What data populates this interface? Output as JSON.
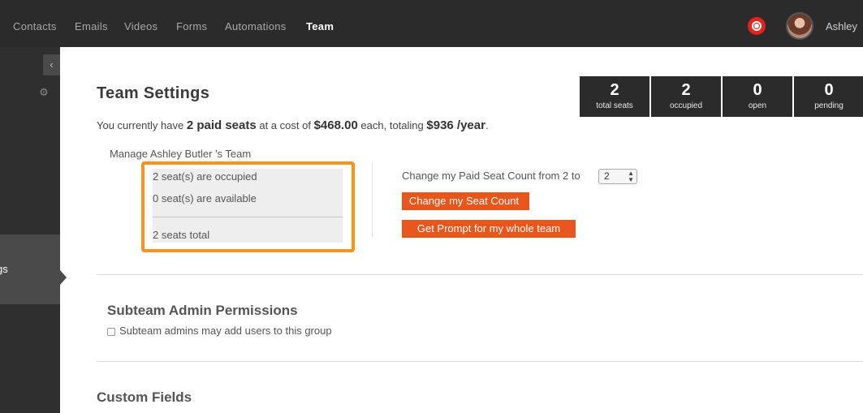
{
  "nav": {
    "items": [
      "Contacts",
      "Emails",
      "Videos",
      "Forms",
      "Automations",
      "Team"
    ],
    "active": "Team",
    "user_name": "Ashley"
  },
  "sidebar": {
    "active_label": "gs",
    "collapse_icon": "chevron-left-icon",
    "settings_icon": "gear-icon"
  },
  "stats": [
    {
      "value": "2",
      "label": "total seats"
    },
    {
      "value": "2",
      "label": "occupied"
    },
    {
      "value": "0",
      "label": "open"
    },
    {
      "value": "0",
      "label": "pending"
    }
  ],
  "page": {
    "title": "Team Settings",
    "summary_prefix": "You currently have",
    "paid_seats": "2 paid seats",
    "summary_mid": "at a cost of",
    "cost_each": "$468.00",
    "summary_each": "each, totaling",
    "total_cost": "$936 /year",
    "summary_end": "."
  },
  "manage": {
    "label": "Manage Ashley Butler 's Team",
    "occupied": "2 seat(s) are occupied",
    "available": "0 seat(s) are available",
    "total": "2 seats total"
  },
  "seat_change": {
    "label": "Change my Paid Seat Count from 2 to",
    "selected": "2",
    "change_button": "Change my Seat Count",
    "prompt_button": "Get Prompt for my whole team"
  },
  "subteam": {
    "title": "Subteam Admin Permissions",
    "checkbox_label": "Subteam admins may add users to this group"
  },
  "custom_fields": {
    "title": "Custom Fields"
  },
  "colors": {
    "nav_bg": "#2b2b2b",
    "accent_orange": "#e8561c",
    "highlight": "#f7931e",
    "record_red": "#e5221b"
  }
}
